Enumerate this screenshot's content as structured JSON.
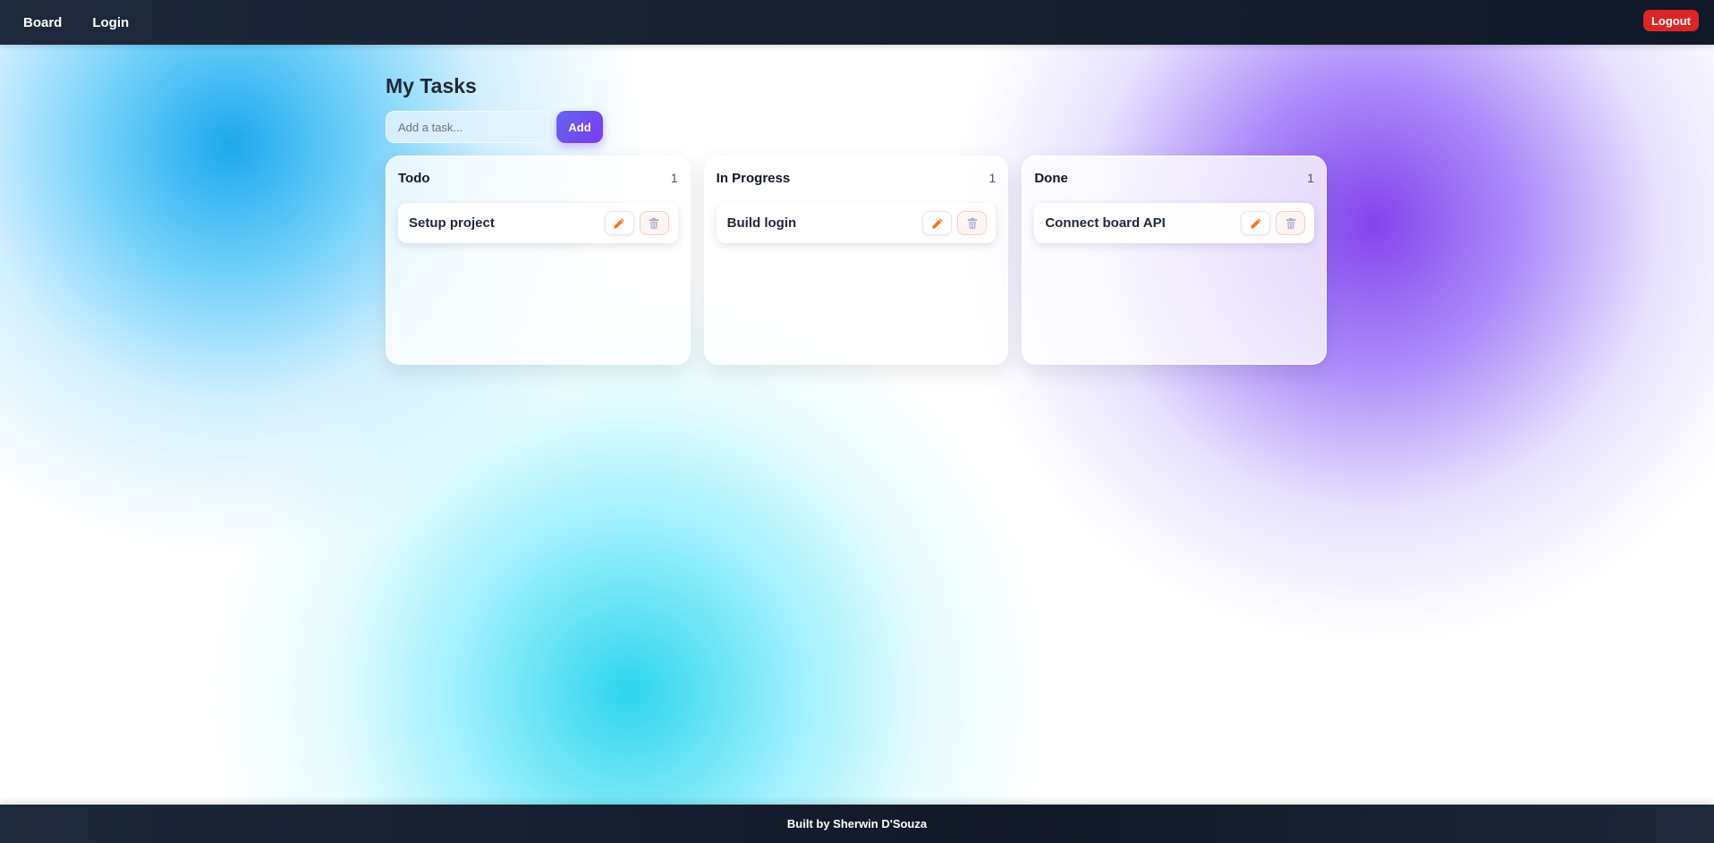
{
  "nav": {
    "links": [
      {
        "label": "Board"
      },
      {
        "label": "Login"
      }
    ],
    "logout_label": "Logout"
  },
  "main": {
    "title": "My Tasks",
    "input": {
      "placeholder": "Add a task...",
      "value": ""
    },
    "add_label": "Add"
  },
  "columns": [
    {
      "title": "Todo",
      "count": "1",
      "tasks": [
        {
          "title": "Setup project"
        }
      ]
    },
    {
      "title": "In Progress",
      "count": "1",
      "tasks": [
        {
          "title": "Build login"
        }
      ]
    },
    {
      "title": "Done",
      "count": "1",
      "tasks": [
        {
          "title": "Connect board API"
        }
      ]
    }
  ],
  "icons": {
    "edit": "pencil-icon",
    "delete": "trash-icon"
  },
  "colors": {
    "logout": "#dc2626",
    "add_button": "#7c3aed",
    "edit_icon": "#f97316",
    "delete_icon": "#a5a8c4",
    "navbar": "#1e293b"
  },
  "footer": {
    "text": "Built by Sherwin D'Souza"
  }
}
